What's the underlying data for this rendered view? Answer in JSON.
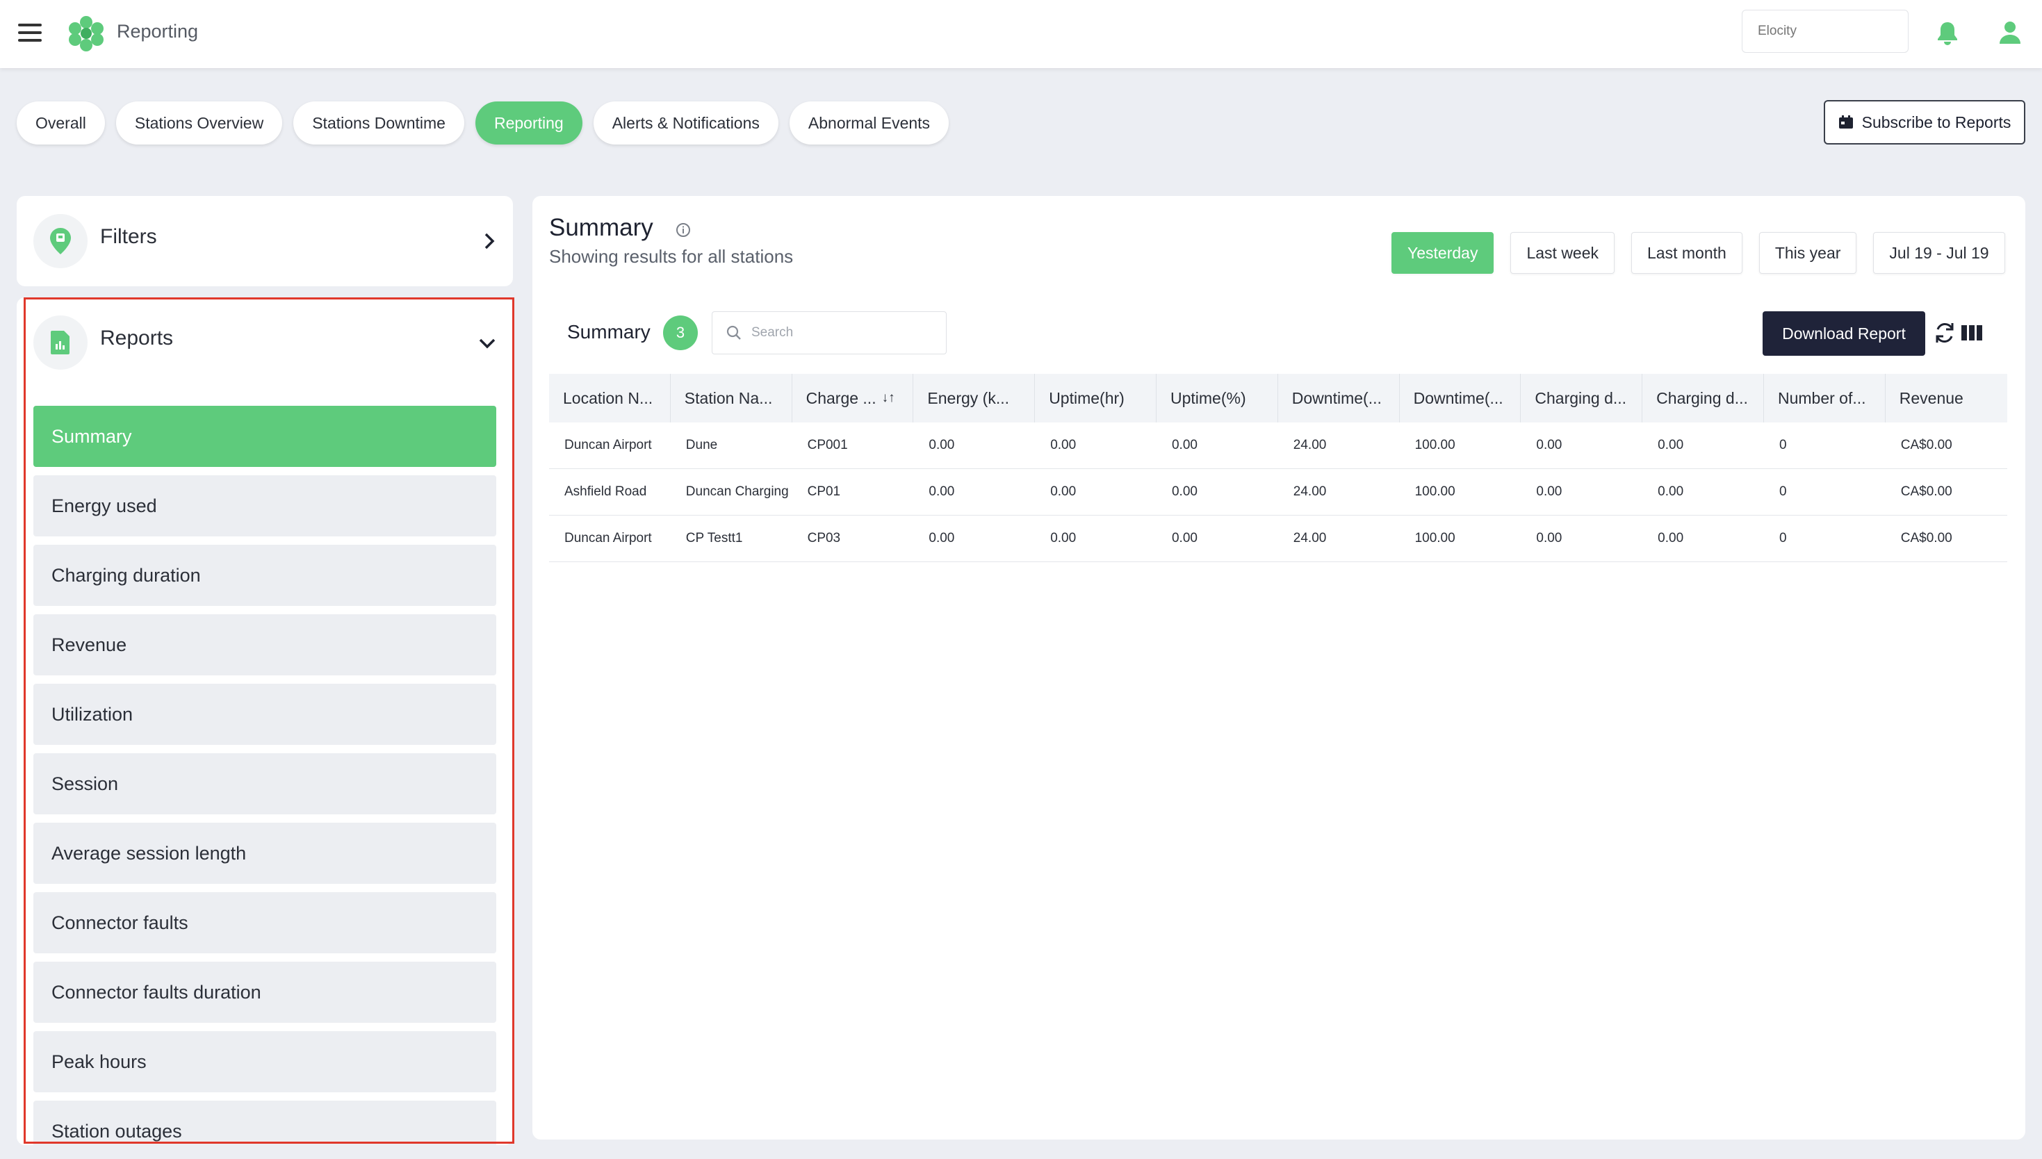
{
  "app": {
    "title": "Reporting",
    "tenant_placeholder": "Elocity"
  },
  "tabs": [
    {
      "label": "Overall",
      "active": false
    },
    {
      "label": "Stations Overview",
      "active": false
    },
    {
      "label": "Stations Downtime",
      "active": false
    },
    {
      "label": "Reporting",
      "active": true
    },
    {
      "label": "Alerts & Notifications",
      "active": false
    },
    {
      "label": "Abnormal Events",
      "active": false
    }
  ],
  "subscribe_label": "Subscribe to Reports",
  "filters": {
    "title": "Filters"
  },
  "reports": {
    "title": "Reports",
    "items": [
      "Summary",
      "Energy used",
      "Charging duration",
      "Revenue",
      "Utilization",
      "Session",
      "Average session length",
      "Connector faults",
      "Connector faults duration",
      "Peak hours",
      "Station outages"
    ],
    "active_index": 0
  },
  "main": {
    "title": "Summary",
    "subtitle": "Showing results for all stations",
    "ranges": [
      "Yesterday",
      "Last week",
      "Last month",
      "This year",
      "Jul 19 - Jul 19"
    ],
    "active_range": 0,
    "table_title": "Summary",
    "count": "3",
    "search_placeholder": "Search",
    "download_label": "Download Report"
  },
  "table": {
    "headers": [
      "Location N...",
      "Station Na...",
      "Charge ...",
      "Energy (k...",
      "Uptime(hr)",
      "Uptime(%)",
      "Downtime(...",
      "Downtime(...",
      "Charging d...",
      "Charging d...",
      "Number of...",
      "Revenue"
    ],
    "rows": [
      [
        "Duncan Airport",
        "Dune",
        "CP001",
        "0.00",
        "0.00",
        "0.00",
        "24.00",
        "100.00",
        "0.00",
        "0.00",
        "0",
        "CA$0.00"
      ],
      [
        "Ashfield Road",
        "Duncan Charging",
        "CP01",
        "0.00",
        "0.00",
        "0.00",
        "24.00",
        "100.00",
        "0.00",
        "0.00",
        "0",
        "CA$0.00"
      ],
      [
        "Duncan Airport",
        "CP Testt1",
        "CP03",
        "0.00",
        "0.00",
        "0.00",
        "24.00",
        "100.00",
        "0.00",
        "0.00",
        "0",
        "CA$0.00"
      ]
    ]
  },
  "colors": {
    "accent": "#5ecb7c",
    "dark_button": "#1f2339",
    "highlight_outline": "#e0382b"
  }
}
